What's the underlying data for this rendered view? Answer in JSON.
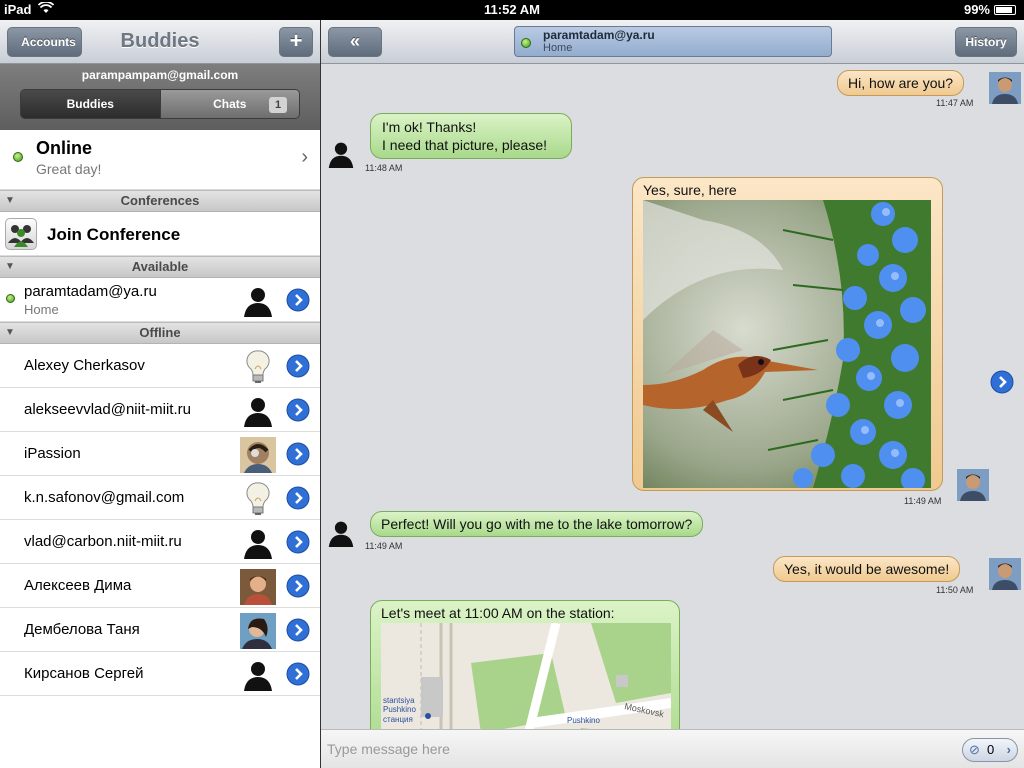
{
  "status_bar": {
    "device": "iPad",
    "time": "11:52 AM",
    "battery": "99%"
  },
  "left": {
    "nav": {
      "back_label": "Accounts",
      "title": "Buddies",
      "add_label": "+"
    },
    "account_email": "parampampam@gmail.com",
    "segments": {
      "buddies": "Buddies",
      "chats": "Chats",
      "chats_count": "1"
    },
    "status": {
      "label": "Online",
      "message": "Great day!"
    },
    "sections": {
      "conferences": "Conferences",
      "available": "Available",
      "offline": "Offline"
    },
    "join_conference": "Join Conference",
    "available_contacts": [
      {
        "name": "paramtadam@ya.ru",
        "sub": "Home",
        "avatar": "silhouette"
      }
    ],
    "offline_contacts": [
      {
        "name": "Alexey Cherkasov",
        "avatar": "lightbulb"
      },
      {
        "name": "alekseevvlad@niit-miit.ru",
        "avatar": "silhouette"
      },
      {
        "name": "iPassion",
        "avatar": "photo"
      },
      {
        "name": "k.n.safonov@gmail.com",
        "avatar": "lightbulb"
      },
      {
        "name": "vlad@carbon.niit-miit.ru",
        "avatar": "silhouette"
      },
      {
        "name": "Алексеев Дима",
        "avatar": "photo"
      },
      {
        "name": "Дембелова Таня",
        "avatar": "photo"
      },
      {
        "name": "Кирсанов Сергей",
        "avatar": "silhouette"
      }
    ]
  },
  "right": {
    "nav": {
      "back_label": "«",
      "contact_name": "paramtadam@ya.ru",
      "contact_sub": "Home",
      "history_label": "History"
    },
    "messages": [
      {
        "dir": "out",
        "text": "Hi, how are you?",
        "time": "11:47 AM"
      },
      {
        "dir": "in",
        "text": "I'm ok! Thanks!",
        "text2": "I need that picture, please!",
        "time": "11:48 AM"
      },
      {
        "dir": "out",
        "text": "Yes, sure, here",
        "time": "11:49 AM",
        "attachment": "hummingbird photo"
      },
      {
        "dir": "in",
        "text": "Perfect! Will you go with me to the lake tomorrow?",
        "time": "11:49 AM"
      },
      {
        "dir": "out",
        "text": "Yes, it would be awesome!",
        "time": "11:50 AM"
      },
      {
        "dir": "in",
        "text": "Let's meet at 11:00 AM on the station:",
        "attachment": "map",
        "map_labels": {
          "a": "stantsiya",
          "b": "Pushkino",
          "c": "станция",
          "d": "Pushkino",
          "e": "Moskovsk"
        }
      }
    ],
    "input": {
      "placeholder": "Type message here",
      "attach_count": "0"
    }
  },
  "colors": {
    "out_bubble": "#f0c98f",
    "in_bubble": "#a8d98b",
    "online": "#3c9a1c",
    "disclosure": "#2f6fd6"
  }
}
